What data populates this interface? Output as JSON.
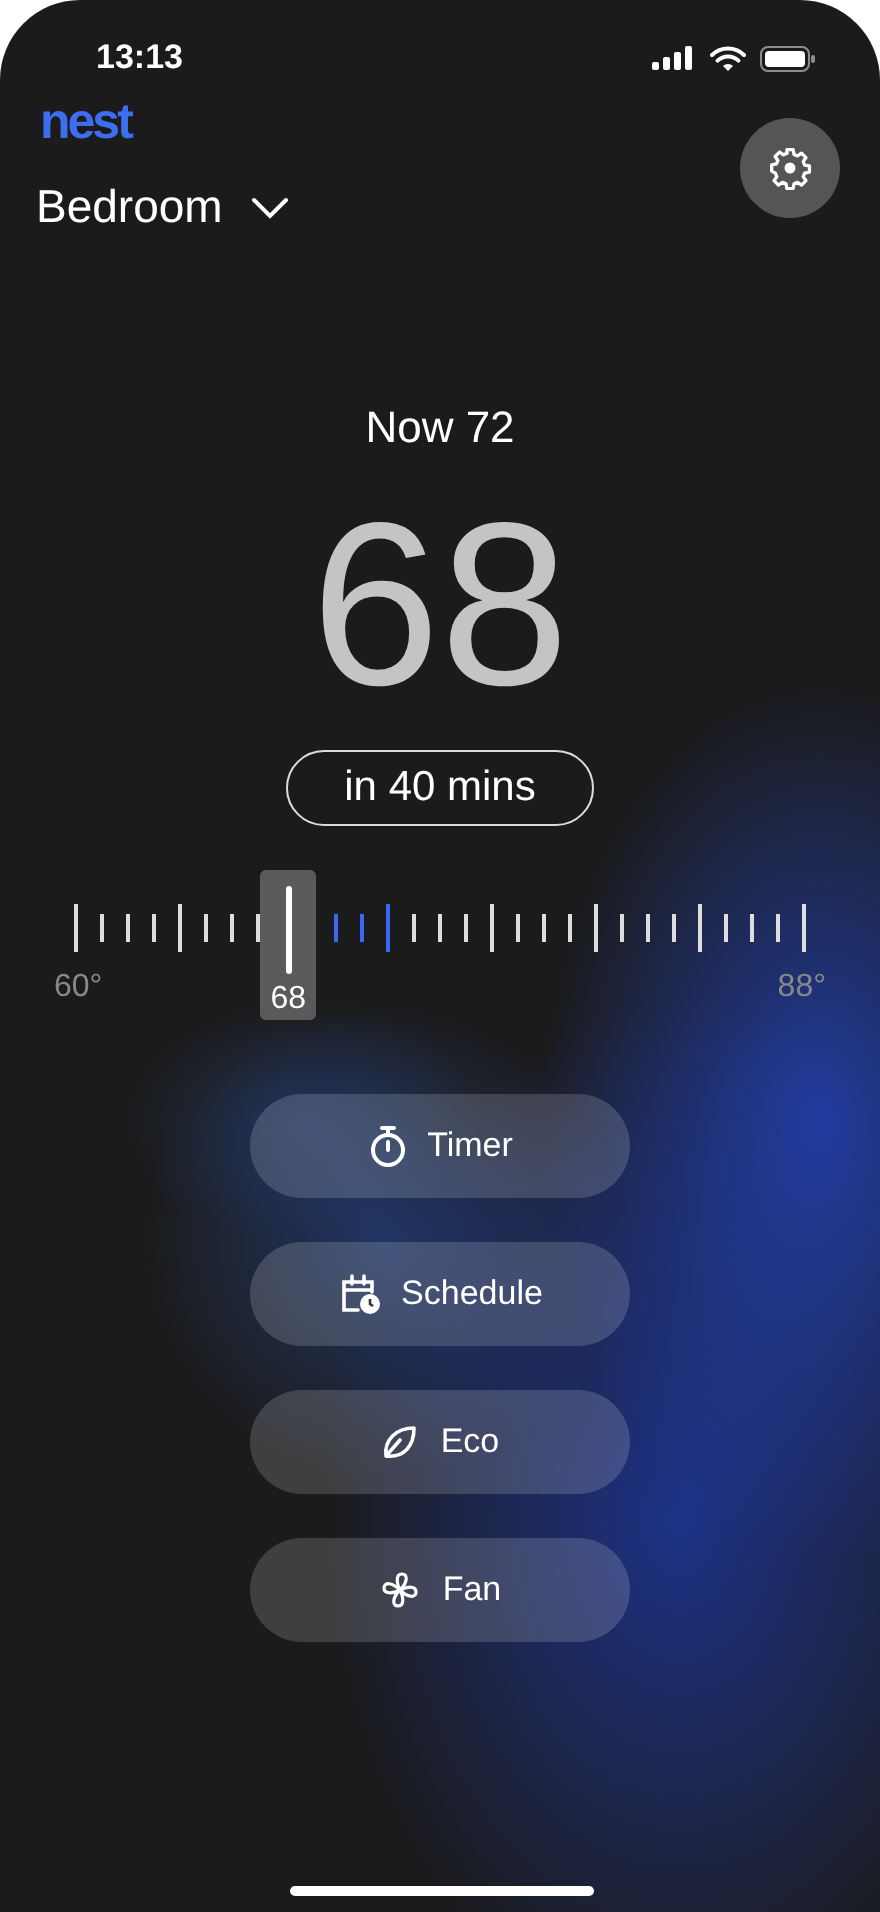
{
  "status_bar": {
    "time": "13:13"
  },
  "logo": "nest",
  "room": {
    "name": "Bedroom"
  },
  "now": "Now 72",
  "setpoint": "68",
  "eta": "in 40 mins",
  "slider": {
    "level": 0.2857,
    "reading": "68",
    "min_label": "60°",
    "max_label": "88°"
  },
  "buttons": [
    {
      "kind": "timer",
      "label": "Timer"
    },
    {
      "kind": "schedule",
      "label": "Schedule"
    },
    {
      "kind": "eco",
      "label": "Eco"
    },
    {
      "kind": "fan",
      "label": "Fan"
    }
  ]
}
